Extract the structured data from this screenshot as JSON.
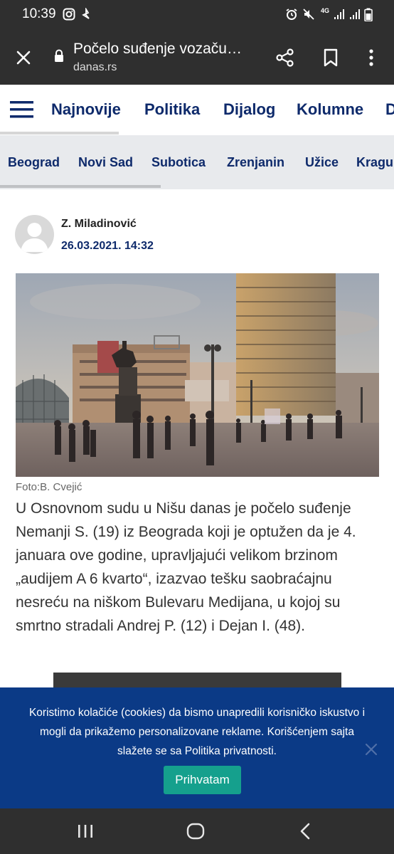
{
  "status_bar": {
    "time": "10:39",
    "network": "4G"
  },
  "browser": {
    "page_title": "Počelo suđenje vozaču…",
    "domain": "danas.rs",
    "icons": [
      "close-icon",
      "lock-icon",
      "share-icon",
      "bookmark-icon",
      "more-vert-icon"
    ]
  },
  "main_nav": {
    "items": [
      "Najnovije",
      "Politika",
      "Dijalog",
      "Kolumne",
      "D"
    ]
  },
  "city_nav": {
    "items": [
      "Beograd",
      "Novi Sad",
      "Subotica",
      "Zrenjanin",
      "Užice",
      "Kragu"
    ]
  },
  "article": {
    "author": "Z. Miladinović",
    "date": "26.03.2021. 14:32",
    "photo_credit": "Foto:B. Cvejić",
    "lead": "U Osnovnom sudu u Nišu danas je počelo suđenje Nemanji S. (19) iz Beograda koji je optužen da je 4. januara ove godine, upravljajući velikom brzinom „audijem A 6 kvarto“, izazvao tešku saobraćajnu nesreću na niškom Bulevaru Medijana, u kojoj su smrtno stradali Andrej P. (12) i Dejan I. (48)."
  },
  "cookie": {
    "text": "Koristimo kolačiće (cookies) da bismo unapredili korisničko iskustvo i mogli da prikažemo personalizovane reklame. Korišćenjem sajta slažete se sa Politika privatnosti.",
    "accept_label": "Prihvatam"
  },
  "colors": {
    "navy": "#0e2a6b",
    "cookie_bg": "#0b3a86",
    "accept_bg": "#15a08d",
    "system_bar": "#2f2f2f"
  }
}
